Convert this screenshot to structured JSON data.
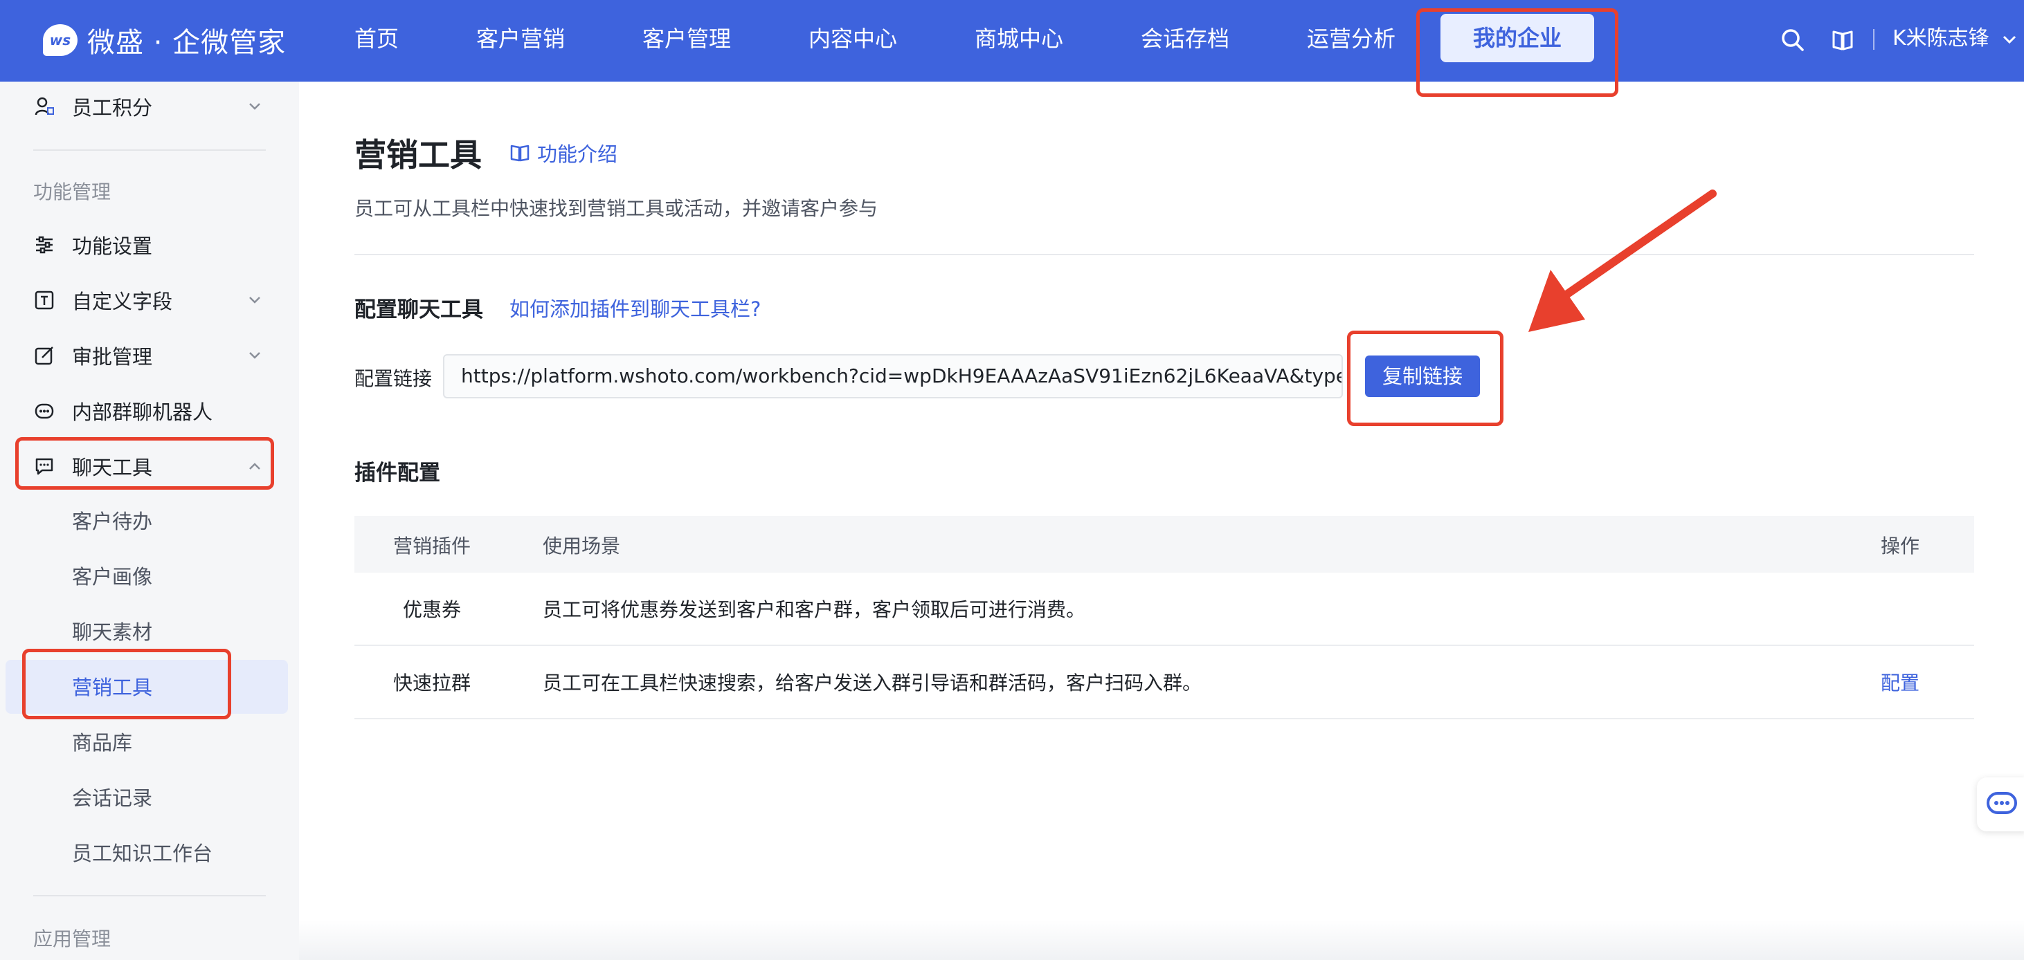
{
  "app": {
    "logo_mark": "ws",
    "name": "微盛 · 企微管家"
  },
  "topnav": {
    "items": [
      "首页",
      "客户营销",
      "客户管理",
      "内容中心",
      "商城中心",
      "会话存档",
      "运营分析"
    ],
    "active": "我的企业",
    "user": "K米陈志锋"
  },
  "sidebar": {
    "top_item": "员工积分",
    "section_function": "功能管理",
    "items": [
      "功能设置",
      "自定义字段",
      "审批管理",
      "内部群聊机器人",
      "聊天工具"
    ],
    "sub_items": [
      "客户待办",
      "客户画像",
      "聊天素材",
      "营销工具",
      "商品库",
      "会话记录",
      "员工知识工作台"
    ],
    "section_app": "应用管理"
  },
  "page": {
    "title": "营销工具",
    "intro_link": "功能介绍",
    "description": "员工可从工具栏中快速找到营销工具或活动，并邀请客户参与"
  },
  "config": {
    "section_title": "配置聊天工具",
    "help_link": "如何添加插件到聊天工具栏?",
    "link_label": "配置链接",
    "link_value": "https://platform.wshoto.com/workbench?cid=wpDkH9EAAAzAaSV91iEzn62jL6KeaaVA&type=m...",
    "copy_button": "复制链接"
  },
  "plugins": {
    "section_title": "插件配置",
    "columns": [
      "营销插件",
      "使用场景",
      "操作"
    ],
    "rows": [
      {
        "name": "优惠券",
        "scene": "员工可将优惠券发送到客户和客户群，客户领取后可进行消费。",
        "action": ""
      },
      {
        "name": "快速拉群",
        "scene": "员工可在工具栏快速搜索，给客户发送入群引导语和群活码，客户扫码入群。",
        "action": "配置"
      }
    ]
  },
  "colors": {
    "brand": "#3e63dd",
    "highlight": "#e8402d"
  }
}
